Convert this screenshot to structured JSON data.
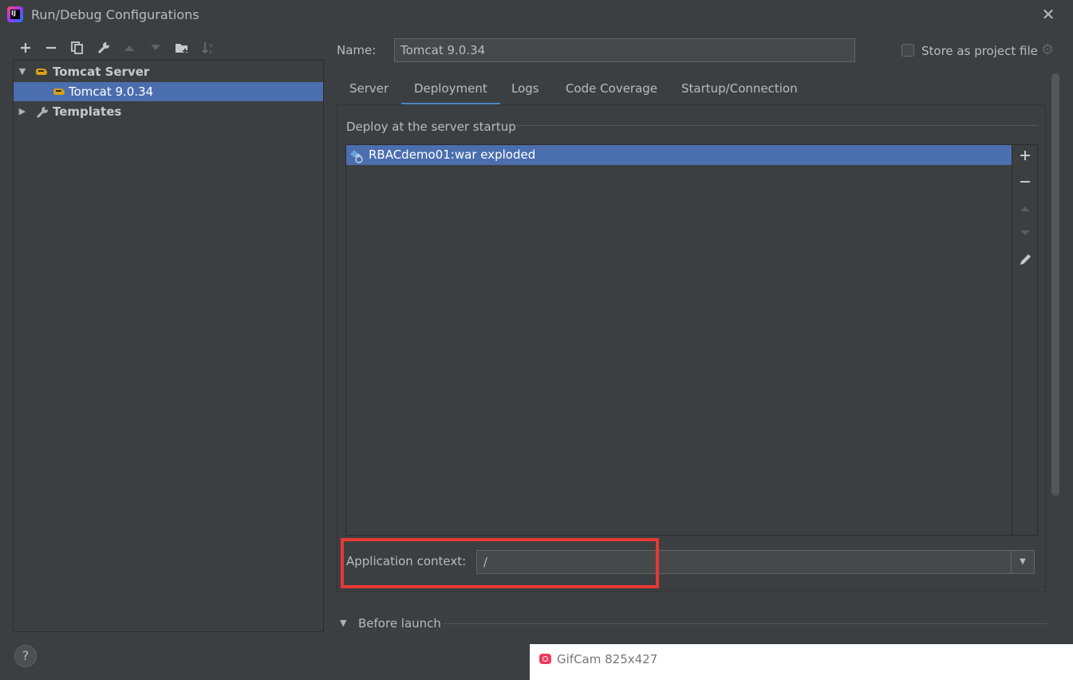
{
  "window": {
    "title": "Run/Debug Configurations",
    "close": "✕"
  },
  "toolbar": {
    "add": "+",
    "remove": "−",
    "copy": "⧉",
    "edit": "🔧",
    "up": "▲",
    "down": "▼",
    "new_folder": "📁",
    "sort": "↓"
  },
  "tree": {
    "groups": [
      {
        "label": "Tomcat Server",
        "expanded": true,
        "icon": "tomcat-icon",
        "children": [
          {
            "label": "Tomcat 9.0.34",
            "selected": true,
            "icon": "tomcat-icon"
          }
        ]
      },
      {
        "label": "Templates",
        "expanded": false,
        "icon": "wrench-icon"
      }
    ]
  },
  "name_field": {
    "label": "Name:",
    "value": "Tomcat 9.0.34"
  },
  "store_project": {
    "label": "Store as project file",
    "checked": false
  },
  "tabs": [
    {
      "label": "Server",
      "active": false
    },
    {
      "label": "Deployment",
      "active": true
    },
    {
      "label": "Logs",
      "active": false
    },
    {
      "label": "Code Coverage",
      "active": false
    },
    {
      "label": "Startup/Connection",
      "active": false
    }
  ],
  "deployment": {
    "section_title": "Deploy at the server startup",
    "items": [
      "RBACdemo01:war exploded"
    ],
    "context_label": "Application context:",
    "context_value": "/"
  },
  "before_launch": {
    "label": "Before launch"
  },
  "help": "?",
  "overlay": {
    "text": "GifCam 825x427"
  },
  "colors": {
    "accent": "#4a88c7",
    "selection": "#4b6eaf",
    "highlight": "#e53935",
    "background": "#3c3f41"
  }
}
